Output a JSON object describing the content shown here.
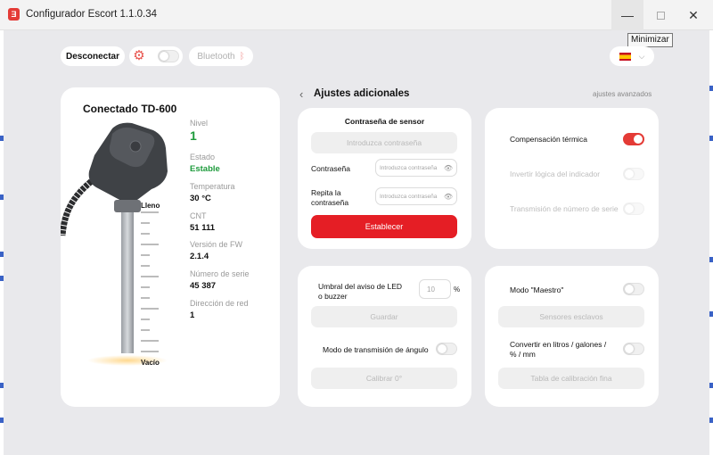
{
  "window": {
    "title": "Configurador Escort 1.1.0.34",
    "tooltip": "Minimizar",
    "app_icon_glyph": "Ǝ"
  },
  "toolbar": {
    "disconnect_label": "Desconectar",
    "bluetooth_label": "Bluetooth",
    "language_flag": "es"
  },
  "sensor": {
    "title": "Conectado  TD-600",
    "stats": [
      {
        "label": "Nivel",
        "value": "1"
      },
      {
        "label": "Estado",
        "value": "Estable"
      },
      {
        "label": "Temperatura",
        "value": "30 °C"
      },
      {
        "label": "CNT",
        "value": "51 111"
      },
      {
        "label": "Versión de FW",
        "value": "2.1.4"
      },
      {
        "label": "Número de serie",
        "value": "45 387"
      },
      {
        "label": "Dirección de red",
        "value": "1"
      }
    ],
    "scale_top": "Lleno",
    "scale_bottom": "Vacío"
  },
  "section": {
    "title": "Ajustes adicionales",
    "advanced_link": "ajustes avanzados"
  },
  "password_card": {
    "title": "Contraseña de sensor",
    "enter_button": "Introduzca contraseña",
    "password_label": "Contraseña",
    "password_placeholder": "Introduzca contraseña",
    "repeat_label": "Repita la contraseña",
    "repeat_placeholder": "Introduzca contraseña",
    "set_button": "Establecer"
  },
  "options_card": {
    "thermal_label": "Compensación térmica",
    "invert_label": "Invertir lógica del indicador",
    "serial_tx_label": "Transmisión de número de serie"
  },
  "led_card": {
    "threshold_label": "Umbral del aviso de LED o buzzer",
    "threshold_placeholder": "10",
    "threshold_unit": "%",
    "save_button": "Guardar",
    "angle_label": "Modo de transmisión de ángulo",
    "calibrate_button": "Calibrar 0°"
  },
  "master_card": {
    "master_label": "Modo \"Maestro\"",
    "slaves_button": "Sensores esclavos",
    "convert_label": "Convertir en litros / galones / % / mm",
    "table_button": "Tabla de calibración fina"
  }
}
